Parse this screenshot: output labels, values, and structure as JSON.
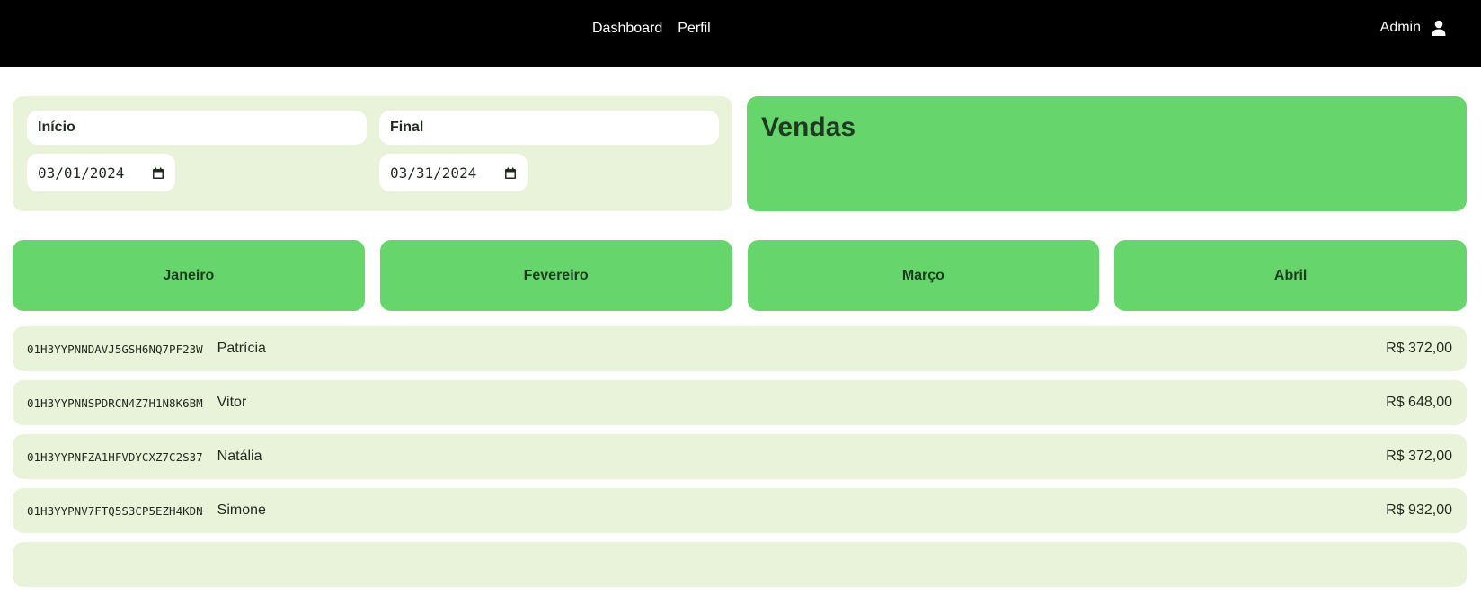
{
  "nav": {
    "items": [
      {
        "label": "Dashboard"
      },
      {
        "label": "Perfil"
      }
    ],
    "user_label": "Admin"
  },
  "filters": {
    "start_label": "Início",
    "start_value": "03/01/2024",
    "end_label": "Final",
    "end_value": "03/31/2024"
  },
  "summary": {
    "title": "Vendas"
  },
  "months": [
    {
      "label": "Janeiro"
    },
    {
      "label": "Fevereiro"
    },
    {
      "label": "Março"
    },
    {
      "label": "Abril"
    }
  ],
  "sales": [
    {
      "id": "01H3YYPNNDAVJ5GSH6NQ7PF23W",
      "name": "Patrícia",
      "amount": "R$ 372,00"
    },
    {
      "id": "01H3YYPNNSPDRCN4Z7H1N8K6BM",
      "name": "Vitor",
      "amount": "R$ 648,00"
    },
    {
      "id": "01H3YYPNFZA1HFVDYCXZ7C2S37",
      "name": "Natália",
      "amount": "R$ 372,00"
    },
    {
      "id": "01H3YYPNV7FTQ5S3CP5EZH4KDN",
      "name": "Simone",
      "amount": "R$ 932,00"
    }
  ],
  "colors": {
    "topbar": "#000000",
    "card_light": "#e8f3d9",
    "accent_green": "#66d66c"
  },
  "icons": {
    "user": "user-icon",
    "calendar": "calendar-icon"
  }
}
